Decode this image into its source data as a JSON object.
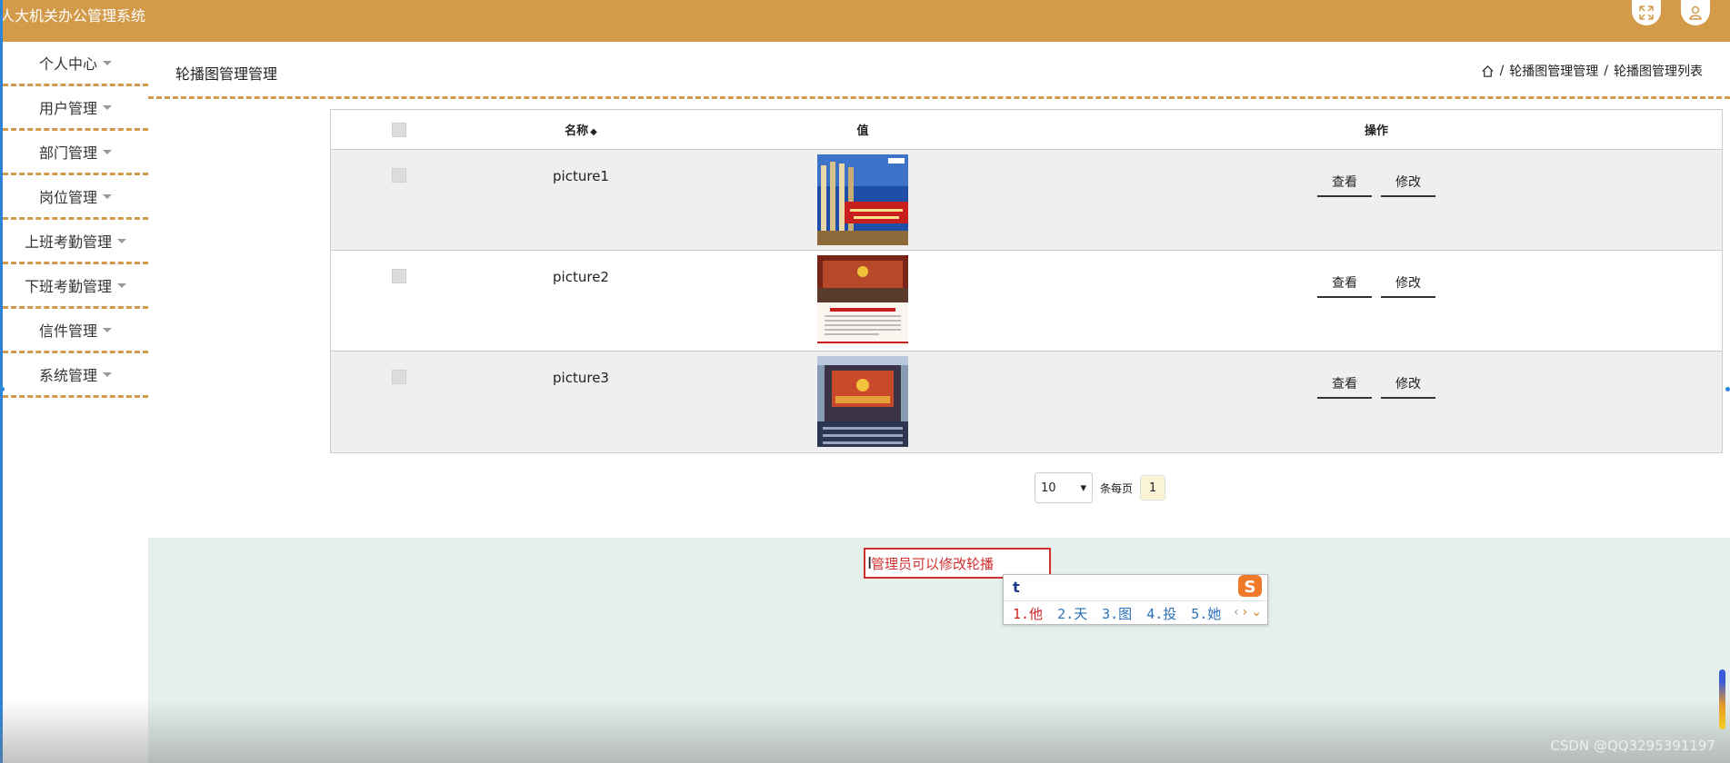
{
  "app": {
    "title": "人大机关办公管理系统"
  },
  "header": {
    "fullscreen_icon": "expand-icon",
    "user_icon": "user-icon"
  },
  "sidebar": {
    "items": [
      {
        "label": "个人中心"
      },
      {
        "label": "用户管理"
      },
      {
        "label": "部门管理"
      },
      {
        "label": "岗位管理"
      },
      {
        "label": "上班考勤管理"
      },
      {
        "label": "下班考勤管理"
      },
      {
        "label": "信件管理"
      },
      {
        "label": "系统管理"
      }
    ]
  },
  "page": {
    "title": "轮播图管理管理",
    "breadcrumb": [
      "轮播图管理管理",
      "轮播图管理列表"
    ],
    "breadcrumb_sep": "/"
  },
  "table": {
    "headers": {
      "name": "名称",
      "sort": "◆",
      "value": "值",
      "ops": "操作"
    },
    "rows": [
      {
        "name": "picture1",
        "view": "查看",
        "edit": "修改"
      },
      {
        "name": "picture2",
        "view": "查看",
        "edit": "修改"
      },
      {
        "name": "picture3",
        "view": "查看",
        "edit": "修改"
      }
    ]
  },
  "pagination": {
    "page_size": "10",
    "per_page_label": "条每页",
    "current_page": "1"
  },
  "note": {
    "text": "管理员可以修改轮播"
  },
  "ime": {
    "input": "t",
    "candidates": [
      "1.他",
      "2.天",
      "3.图",
      "4.投",
      "5.她"
    ]
  },
  "watermark": "CSDN @QQ3295391197",
  "colors": {
    "accent": "#d39a4a",
    "panel": "#e5f0ec",
    "note_red": "#d03030"
  }
}
